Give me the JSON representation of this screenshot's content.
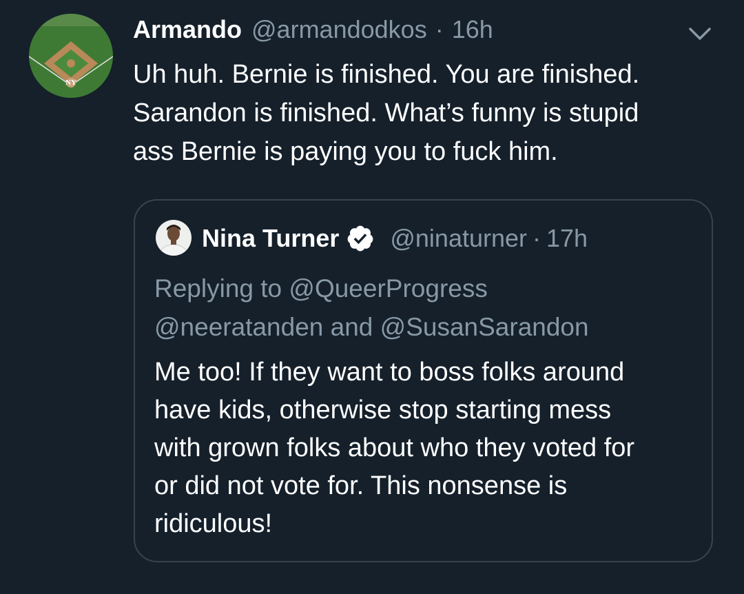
{
  "tweet": {
    "author_name": "Armando",
    "author_handle": "@armandodkos",
    "separator": "·",
    "time": "16h",
    "avatar_icon": "baseball-field-avatar-icon",
    "menu_icon": "chevron-down-icon",
    "text_lines": [
      "Uh huh. Bernie is finished. You are finished.",
      "Sarandon is finished. What’s funny is stupid",
      "ass Bernie is paying you to fuck him."
    ]
  },
  "quoted": {
    "author_name": "Nina Turner",
    "author_handle": "@ninaturner",
    "separator": "·",
    "time": "17h",
    "avatar_icon": "person-avatar-icon",
    "verified_icon": "verified-badge-icon",
    "reply_lines": [
      "Replying to @QueerProgress",
      "@neeratanden and @SusanSarandon"
    ],
    "text_lines": [
      "Me too! If they want to boss folks around",
      "have kids, otherwise stop starting mess",
      "with grown folks about who they voted for",
      "or did not vote for. This nonsense is",
      "ridiculous!"
    ]
  },
  "colors": {
    "background": "#15202b",
    "primary_text": "#ffffff",
    "secondary_text": "#8899a6",
    "border": "#38444d"
  }
}
